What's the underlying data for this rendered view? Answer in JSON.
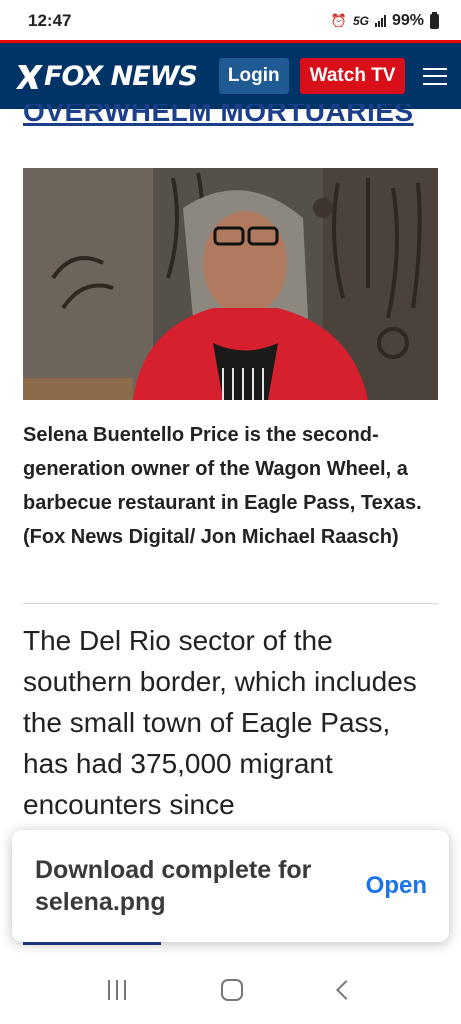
{
  "status_bar": {
    "time": "12:47",
    "network": "5G",
    "battery": "99%",
    "alarm_icon": "alarm-icon",
    "signal_icon": "signal-icon",
    "battery_icon": "battery-icon"
  },
  "header": {
    "logo_text": "FOX NEWS",
    "login_label": "Login",
    "watch_label": "Watch TV",
    "menu_icon": "hamburger-menu-icon",
    "colors": {
      "bg": "#003366",
      "accent": "#d80e18",
      "login": "#1f5a92"
    }
  },
  "article": {
    "headline_tail": "OVERWHELM MORTUARIES",
    "photo_alt": "Selena Buentello Price",
    "caption": "Selena Buentello Price is the second-generation owner of the Wagon Wheel, a barbecue restaurant in Eagle Pass, Texas.  (Fox News Digital/ Jon Michael Raasch)",
    "body": "The Del Rio sector of the southern border, which includes the small town of Eagle Pass, has had 375,000 migrant encounters since"
  },
  "toast": {
    "message": "Download complete for selena.png",
    "action": "Open"
  },
  "nav": {
    "recents_icon": "recents-icon",
    "home_icon": "home-icon",
    "back_icon": "back-icon"
  }
}
